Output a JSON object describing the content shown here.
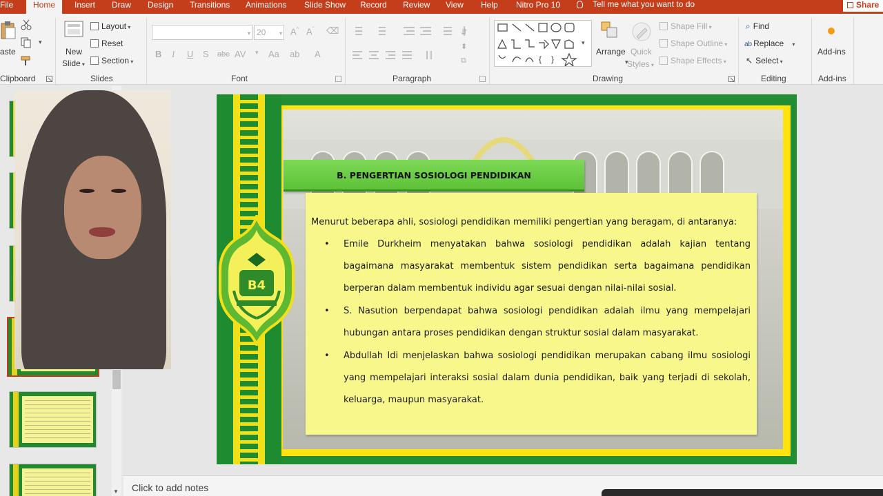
{
  "ribbon_tabs": [
    "File",
    "Home",
    "Insert",
    "Draw",
    "Design",
    "Transitions",
    "Animations",
    "Slide Show",
    "Record",
    "Review",
    "View",
    "Help",
    "Nitro Pro 10"
  ],
  "tell_me": "Tell me what you want to do",
  "share": "Share",
  "clipboard": {
    "paste": "aste",
    "group": "Clipboard"
  },
  "slides_group": {
    "new_slide_1": "New",
    "new_slide_2": "Slide",
    "layout": "Layout",
    "reset": "Reset",
    "section": "Section",
    "group": "Slides"
  },
  "font_group": {
    "size": "20",
    "group": "Font"
  },
  "paragraph_group": {
    "group": "Paragraph"
  },
  "drawing_group": {
    "arrange": "Arrange",
    "quick_styles_1": "Quick",
    "quick_styles_2": "Styles",
    "shape_fill": "Shape Fill",
    "shape_outline": "Shape Outline",
    "shape_effects": "Shape Effects",
    "group": "Drawing"
  },
  "editing_group": {
    "find": "Find",
    "replace": "Replace",
    "select": "Select",
    "group": "Editing"
  },
  "addins_group": {
    "addins": "Add-ins",
    "group": "Add-ins"
  },
  "slide": {
    "title": "B. PENGERTIAN SOSIOLOGI PENDIDIKAN",
    "intro": "Menurut beberapa ahli, sosiologi pendidikan memiliki pengertian yang beragam, di antaranya:",
    "bullets": [
      "Emile Durkheim menyatakan bahwa sosiologi pendidikan adalah kajian tentang bagaimana masyarakat membentuk sistem pendidikan serta bagaimana pendidikan berperan dalam membentuk individu agar sesuai dengan nilai-nilai sosial.",
      "S. Nasution berpendapat bahwa sosiologi pendidikan adalah ilmu yang mempelajari hubungan antara proses pendidikan dengan struktur sosial dalam masyarakat.",
      "Abdullah Idi menjelaskan bahwa sosiologi pendidikan merupakan cabang ilmu sosiologi yang mempelajari interaksi sosial dalam dunia pendidikan, baik yang terjadi di sekolah, keluarga, maupun masyarakat."
    ],
    "logo_text": "B4"
  },
  "notes_placeholder": "Click to add notes",
  "colors": {
    "accent": "#c43e1c",
    "slide_green": "#218e33",
    "slide_yellow": "#ffe310",
    "content_bg": "#f7f78b"
  }
}
